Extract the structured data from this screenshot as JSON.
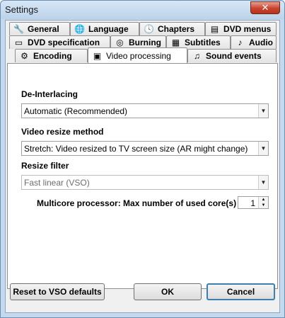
{
  "window": {
    "title": "Settings",
    "close_glyph": "✕"
  },
  "tabs_row1": [
    {
      "label": "General",
      "icon": "wrench-icon",
      "glyph": "🔧"
    },
    {
      "label": "Language",
      "icon": "globe-icon",
      "glyph": "🌐"
    },
    {
      "label": "Chapters",
      "icon": "clock-icon",
      "glyph": "🕓"
    },
    {
      "label": "DVD menus",
      "icon": "menu-list-icon",
      "glyph": "▤"
    }
  ],
  "tabs_row2": [
    {
      "label": "DVD specification",
      "icon": "monitor-icon",
      "glyph": "▭"
    },
    {
      "label": "Burning",
      "icon": "disc-icon",
      "glyph": "◎"
    },
    {
      "label": "Subtitles",
      "icon": "subtitles-icon",
      "glyph": "▦"
    },
    {
      "label": "Audio",
      "icon": "music-note-icon",
      "glyph": "♪"
    }
  ],
  "tabs_row3": [
    {
      "label": "Encoding",
      "icon": "gear-icon",
      "glyph": "⚙"
    },
    {
      "label": "Video processing",
      "icon": "video-processing-icon",
      "glyph": "▣",
      "active": true
    },
    {
      "label": "Sound events",
      "icon": "sound-events-icon",
      "glyph": "♫"
    }
  ],
  "settings": {
    "deinterlacing": {
      "label": "De-Interlacing",
      "value": "Automatic (Recommended)"
    },
    "resize_method": {
      "label": "Video resize method",
      "value": "Stretch: Video resized to TV screen size (AR might change)"
    },
    "resize_filter": {
      "label": "Resize filter",
      "value": "Fast linear (VSO)"
    },
    "multicore": {
      "label": "Multicore processor: Max number of used core(s)",
      "value": "1"
    }
  },
  "buttons": {
    "reset": "Reset to VSO defaults",
    "ok": "OK",
    "cancel": "Cancel"
  },
  "icons": {
    "dropdown_arrow": "▼",
    "spin_up": "▲",
    "spin_down": "▼"
  },
  "colors": {
    "title_bar": "#c5d9ee",
    "close_button": "#c9432c",
    "panel_bg": "#ffffff"
  }
}
